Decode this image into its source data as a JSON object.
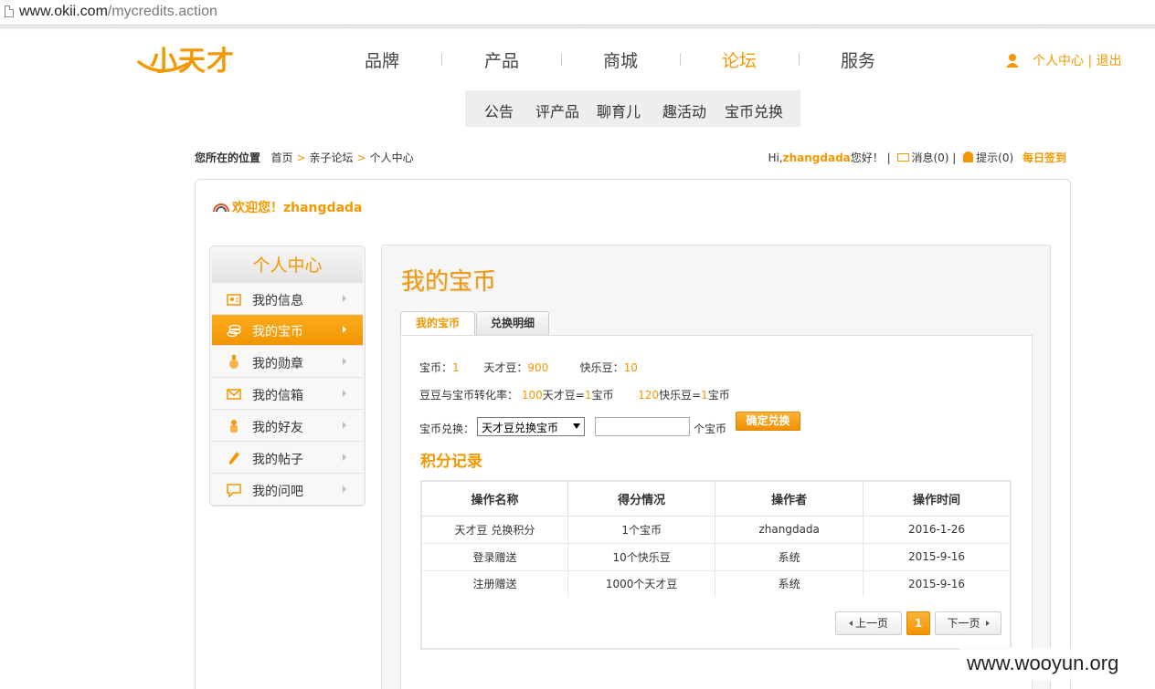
{
  "browser": {
    "url_host": "www.okii.com",
    "url_path": "/mycredits.action"
  },
  "logo": {
    "text": "小天才"
  },
  "main_nav": [
    "品牌",
    "产品",
    "商城",
    "论坛",
    "服务"
  ],
  "main_nav_active": "论坛",
  "user_links": "个人中心 | 退出",
  "sub_nav": [
    "公告",
    "评产品",
    "聊育儿",
    "趣活动",
    "宝币兑换"
  ],
  "breadcrumb": {
    "label": "您所在的位置",
    "items": [
      "首页",
      "亲子论坛",
      "个人中心"
    ],
    "sep": ">"
  },
  "top_right": {
    "hi": "Hi,",
    "username": "zhangdada",
    "greet": "您好！ |",
    "messages": "消息(0)",
    "bar": "|",
    "tips": "提示(0)",
    "signin": "每日签到"
  },
  "welcome": "欢迎您！zhangdada",
  "side_menu": {
    "title": "个人中心",
    "items": [
      {
        "label": "我的信息",
        "icon": "profile-card-icon"
      },
      {
        "label": "我的宝币",
        "icon": "coins-icon"
      },
      {
        "label": "我的勋章",
        "icon": "medal-icon"
      },
      {
        "label": "我的信箱",
        "icon": "envelope-icon"
      },
      {
        "label": "我的好友",
        "icon": "friends-icon"
      },
      {
        "label": "我的帖子",
        "icon": "pencil-icon"
      },
      {
        "label": "我的问吧",
        "icon": "chat-bubble-icon"
      }
    ],
    "active_index": 1
  },
  "page_title": "我的宝币",
  "tabs": [
    "我的宝币",
    "兑换明细"
  ],
  "balances": {
    "coin_label": "宝币：",
    "coin_value": "1",
    "tiancai_label": "天才豆：",
    "tiancai_value": "900",
    "kuaile_label": "快乐豆：",
    "kuaile_value": "10"
  },
  "rate": {
    "label": "豆豆与宝币转化率：",
    "a_num": "100",
    "a_text": "天才豆=",
    "a_eq": "1",
    "a_unit": "宝币",
    "b_num": "120",
    "b_text": "快乐豆=",
    "b_eq": "1",
    "b_unit": "宝币"
  },
  "exchange": {
    "label": "宝币兑换：",
    "selected": "天才豆兑换宝币",
    "amount_value": "",
    "unit": "个宝币",
    "confirm": "确定兑换"
  },
  "records": {
    "title": "积分记录",
    "headers": [
      "操作名称",
      "得分情况",
      "操作者",
      "操作时间"
    ],
    "rows": [
      [
        "天才豆 兑换积分",
        "1个宝币",
        "zhangdada",
        "2016-1-26"
      ],
      [
        "登录赠送",
        "10个快乐豆",
        "系统",
        "2015-9-16"
      ],
      [
        "注册赠送",
        "1000个天才豆",
        "系统",
        "2015-9-16"
      ]
    ]
  },
  "pagination": {
    "prev": "上一页",
    "current": "1",
    "next": "下一页"
  },
  "watermark": "www.wooyun.org",
  "colors": {
    "accent": "#f39800"
  }
}
